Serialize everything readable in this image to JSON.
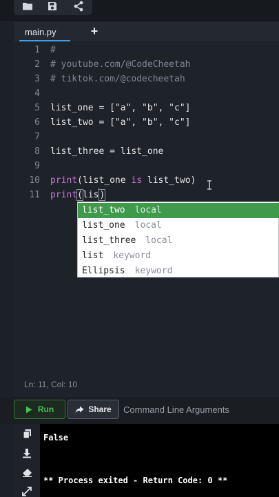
{
  "toolbar": {
    "icons": [
      "folder-icon",
      "save-icon",
      "share-icon"
    ]
  },
  "tabs": {
    "active": "main.py",
    "add_label": "+"
  },
  "editor": {
    "line_numbers": [
      "1",
      "2",
      "3",
      "4",
      "5",
      "6",
      "7",
      "8",
      "9",
      "10",
      "11"
    ],
    "lines": [
      "#",
      "# youtube.com/@CodeCheetah",
      "# tiktok.com/@codecheetah",
      "",
      "list_one = [\"a\", \"b\", \"c\"]",
      "list_two = [\"a\", \"b\", \"c\"]",
      "",
      "list_three = list_one",
      "",
      "print(list_one is list_two)",
      "print(lis)"
    ],
    "line10": {
      "kw": "print",
      "a": "(list_one ",
      "is": "is",
      "b": " list_two)"
    },
    "line11": {
      "kw": "print",
      "open": "(",
      "typed": "lis",
      "close": ")"
    }
  },
  "autocomplete": {
    "items": [
      {
        "name": "list_two",
        "type": "local",
        "selected": true
      },
      {
        "name": "list_one",
        "type": "local",
        "selected": false
      },
      {
        "name": "list_three",
        "type": "local",
        "selected": false
      },
      {
        "name": "list",
        "type": "keyword",
        "selected": false
      },
      {
        "name": "Ellipsis",
        "type": "keyword",
        "selected": false
      }
    ]
  },
  "status": {
    "position": "Ln: 11,  Col: 10"
  },
  "actions": {
    "run_label": "Run",
    "share_label": "Share",
    "cla_placeholder": "Command Line Arguments"
  },
  "console": {
    "side_icons": [
      "copy-icon",
      "download-icon",
      "eraser-icon",
      "expand-icon"
    ],
    "lines": [
      "False",
      "** Process exited - Return Code: 0 **"
    ]
  },
  "colors": {
    "accent_green": "#45c24f",
    "selection_green": "#3f9a4c",
    "keyword_purple": "#c678dd",
    "tab_underline": "#3aa0f0"
  }
}
